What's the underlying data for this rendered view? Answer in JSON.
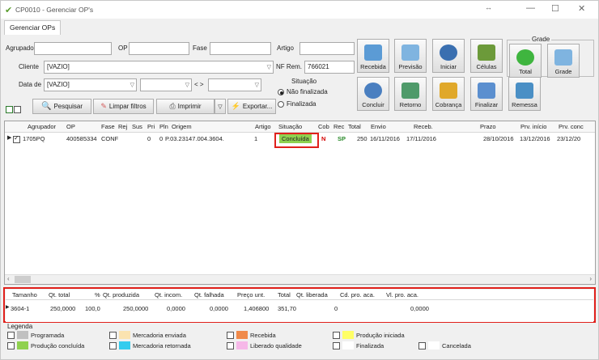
{
  "window": {
    "title": "CP0010 - Gerenciar OP's"
  },
  "tabs": [
    "Gerenciar OPs"
  ],
  "filters": {
    "agrupador_label": "Agrupador",
    "agrupador_value": "",
    "op_label": "OP",
    "op_value": "",
    "fase_label": "Fase",
    "fase_value": "",
    "artigo_label": "Artigo",
    "artigo_value": "",
    "cliente_label": "Cliente",
    "cliente_value": "[VAZIO]",
    "nfrem_label": "NF Rem.",
    "nfrem_value": "766021",
    "data_label": "Data de",
    "data_value": "[VAZIO]",
    "range_sep": "< >"
  },
  "situacao": {
    "label": "Situação",
    "options": [
      "Não finalizada",
      "Finalizada"
    ],
    "selected": 0
  },
  "actions": {
    "pesquisar": "Pesquisar",
    "limpar": "Limpar filtros",
    "imprimir": "Imprimir",
    "exportar": "Exportar..."
  },
  "toolbar": [
    {
      "label": "Recebida",
      "color": "#5b9bd5"
    },
    {
      "label": "Previsão",
      "color": "#7fb4e0"
    },
    {
      "label": "Iniciar",
      "color": "#3a6fb0"
    },
    {
      "label": "Células",
      "color": "#6c9a3a"
    },
    {
      "label": "Concluir",
      "color": "#4a7fc0"
    },
    {
      "label": "Retorno",
      "color": "#4f9a6a"
    },
    {
      "label": "Cobrança",
      "color": "#e0a82a"
    },
    {
      "label": "Finalizar",
      "color": "#5b8fcf"
    },
    {
      "label": "Remessa",
      "color": "#4a8fc5"
    }
  ],
  "grade_group": {
    "title": "Grade",
    "total_label": "Total",
    "grade_label": "Grade"
  },
  "main_table": {
    "columns": [
      "Agrupador",
      "OP",
      "Fase",
      "Rej",
      "Sus",
      "Pri",
      "Pln",
      "Origem",
      "Artigo",
      "Situação",
      "Cob",
      "Rec",
      "Total",
      "Envio",
      "Receb.",
      "Prazo",
      "Prv. início",
      "Prv. conc"
    ],
    "rows": [
      {
        "agrupador": "1705PQ",
        "op": "400585334",
        "fase": "CONF",
        "rej": "",
        "sus": "",
        "pri": "0",
        "pln": "0",
        "origem": "P.03.23147.004.3604.",
        "artigo": "1",
        "situacao": "Concluída",
        "cob": "N",
        "rec": "SP",
        "total": "250",
        "envio": "16/11/2016",
        "receb": "17/11/2016",
        "prazo": "28/10/2016",
        "prv_inicio": "13/12/2016",
        "prv_conc": "23/12/20"
      }
    ]
  },
  "detail_table": {
    "columns": [
      "Tamanho",
      "Qt. total",
      "%",
      "Qt. produzida",
      "Qt. incom.",
      "Qt. falhada",
      "Preço unt.",
      "Total",
      "Qt. liberada",
      "Cd. pro. aca.",
      "Vl. pro. aca."
    ],
    "rows": [
      {
        "tamanho": "3604-1",
        "qt_total": "250,0000",
        "pct": "100,0",
        "qt_produzida": "250,0000",
        "qt_incom": "0,0000",
        "qt_falhada": "0,0000",
        "preco": "1,406800",
        "total": "351,70",
        "qt_liberada": "0",
        "cd": "",
        "vl": "0,0000"
      }
    ]
  },
  "legend": {
    "title": "Legenda",
    "items": [
      {
        "label": "Programada",
        "color": "#c0c0c0"
      },
      {
        "label": "Mercadoria enviada",
        "color": "#fbe3b0"
      },
      {
        "label": "Recebida",
        "color": "#f08a4b"
      },
      {
        "label": "Produção iniciada",
        "color": "#ffff66"
      },
      {
        "label": "Produção concluída",
        "color": "#8fd14f"
      },
      {
        "label": "Mercadoria retornada",
        "color": "#33ccee"
      },
      {
        "label": "Liberado qualidade",
        "color": "#f6b8e8"
      },
      {
        "label": "Finalizada",
        "color": "#ffffff"
      },
      {
        "label": "Cancelada",
        "color": "#ffffff"
      }
    ]
  },
  "colors": {
    "highlight": "#e0201b",
    "concluida": "#8fd14f",
    "cob": "#d40000",
    "rec": "#2a8a2a"
  }
}
